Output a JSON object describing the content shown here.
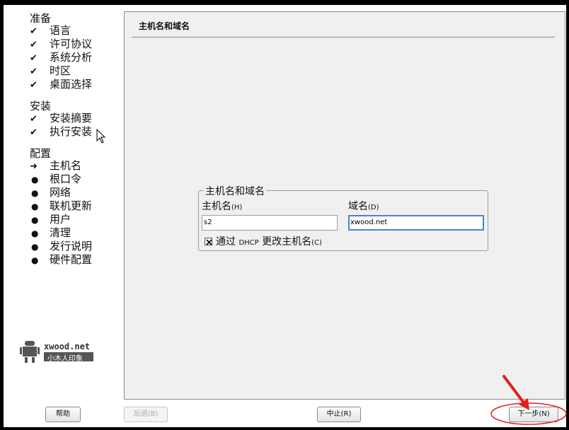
{
  "sidebar": {
    "sections": [
      {
        "title": "准备",
        "steps": [
          {
            "label": "语言",
            "status": "done"
          },
          {
            "label": "许可协议",
            "status": "done"
          },
          {
            "label": "系统分析",
            "status": "done"
          },
          {
            "label": "时区",
            "status": "done"
          },
          {
            "label": "桌面选择",
            "status": "done"
          }
        ]
      },
      {
        "title": "安装",
        "steps": [
          {
            "label": "安装摘要",
            "status": "done"
          },
          {
            "label": "执行安装",
            "status": "done"
          }
        ]
      },
      {
        "title": "配置",
        "steps": [
          {
            "label": "主机名",
            "status": "current"
          },
          {
            "label": "根口令",
            "status": "pending"
          },
          {
            "label": "网络",
            "status": "pending"
          },
          {
            "label": "联机更新",
            "status": "pending"
          },
          {
            "label": "用户",
            "status": "pending"
          },
          {
            "label": "清理",
            "status": "pending"
          },
          {
            "label": "发行说明",
            "status": "pending"
          },
          {
            "label": "硬件配置",
            "status": "pending"
          }
        ]
      }
    ],
    "logo": {
      "brand": "xwood.net",
      "subtitle": "小木人印象"
    }
  },
  "main": {
    "title": "主机名和域名",
    "group": {
      "title": "主机名和域名",
      "hostname_label": "主机名",
      "hostname_accel": "(H)",
      "hostname_value": "s2",
      "domain_label": "域名",
      "domain_accel": "(D)",
      "domain_value": "xwood.net",
      "dhcp_label_pre": "通过 ",
      "dhcp_label_mid": "DHCP",
      "dhcp_label_post": " 更改主机名",
      "dhcp_accel": "(C)",
      "dhcp_checked": true
    }
  },
  "buttons": {
    "help": "帮助",
    "back": "后退(B)",
    "abort": "中止(R)",
    "next": "下一步(N)"
  },
  "colors": {
    "annotation": "#e02020",
    "focus": "#4a86c8"
  }
}
